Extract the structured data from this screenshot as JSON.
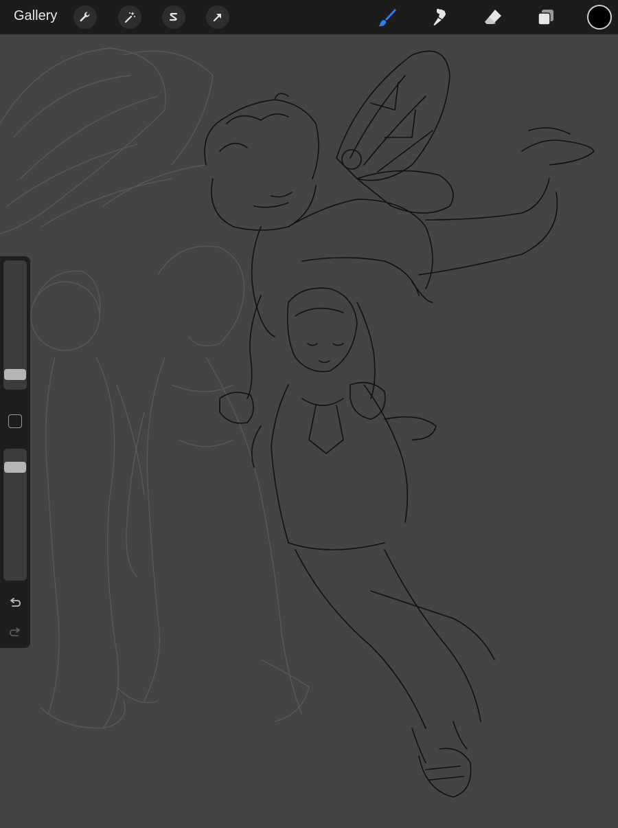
{
  "topbar": {
    "gallery_label": "Gallery",
    "left_tools": [
      {
        "name": "actions",
        "icon": "wrench-icon"
      },
      {
        "name": "adjustments",
        "icon": "magic-wand-icon"
      },
      {
        "name": "selection",
        "icon": "selection-s-icon"
      },
      {
        "name": "transform",
        "icon": "arrow-icon"
      }
    ],
    "right_tools": [
      {
        "name": "brush",
        "icon": "brush-icon",
        "active": true
      },
      {
        "name": "smudge",
        "icon": "smudge-icon"
      },
      {
        "name": "eraser",
        "icon": "eraser-icon"
      },
      {
        "name": "layers",
        "icon": "layers-icon"
      }
    ],
    "current_color": "#000000",
    "active_color": "#2f7cf6"
  },
  "sidebar": {
    "brush_size_level": 0.93,
    "opacity_level": 0.1,
    "undo_icon": "undo-icon",
    "redo_icon": "redo-icon"
  },
  "colors": {
    "toolbar_bg": "#1c1c1c",
    "canvas_bg": "#444444",
    "line_art": "#101010",
    "sketch_lines": "#5c5c5c"
  }
}
